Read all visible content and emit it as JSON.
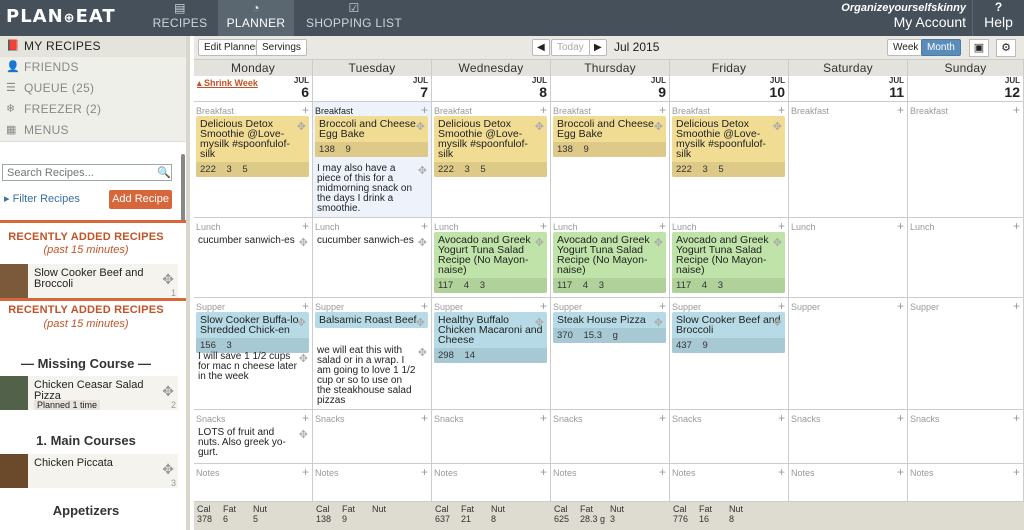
{
  "app": {
    "logo": "PLAN TO EAT"
  },
  "nav": {
    "recipes": "RECIPES",
    "planner": "PLANNER",
    "shopping": "SHOPPING LIST"
  },
  "account": {
    "user": "Organizeyourselfskinny",
    "label": "My Account",
    "help": "Help"
  },
  "sidebar": {
    "items": [
      {
        "label": "MY RECIPES",
        "icon": "book-icon"
      },
      {
        "label": "FRIENDS",
        "icon": "person-icon"
      },
      {
        "label": "QUEUE (25)",
        "icon": "list-icon"
      },
      {
        "label": "FREEZER (2)",
        "icon": "snowflake-icon"
      },
      {
        "label": "MENUS",
        "icon": "menu-icon"
      }
    ],
    "search_placeholder": "Search Recipes...",
    "filter": "Filter Recipes",
    "add_recipe": "Add Recipe",
    "recent_title": "RECENTLY ADDED RECIPES",
    "recent_sub": "(past 15 minutes)",
    "recent_item": "Slow Cooker Beef and Broccoli",
    "recent_count": "1",
    "missing": "— Missing Course —",
    "missing_item": "Chicken Ceasar Salad Pizza",
    "missing_badge": "Planned 1 time",
    "missing_count": "2",
    "main_courses": "1. Main Courses",
    "main_item": "Chicken Piccata",
    "main_count": "3",
    "appetizers": "Appetizers"
  },
  "toolbar": {
    "edit_planner": "Edit Planner",
    "servings": "Servings",
    "today": "Today",
    "month_title": "Jul 2015",
    "week": "Week",
    "month": "Month"
  },
  "calendar": {
    "shrink": "Shrink Week",
    "month_abbr": "JUL",
    "days": [
      {
        "name": "Monday",
        "date": "6"
      },
      {
        "name": "Tuesday",
        "date": "7"
      },
      {
        "name": "Wednesday",
        "date": "8"
      },
      {
        "name": "Thursday",
        "date": "9"
      },
      {
        "name": "Friday",
        "date": "10"
      },
      {
        "name": "Saturday",
        "date": "11"
      },
      {
        "name": "Sunday",
        "date": "12"
      }
    ],
    "slots": [
      "Breakfast",
      "Lunch",
      "Supper",
      "Snacks",
      "Notes"
    ],
    "cards": {
      "mon_b": {
        "name": "Delicious Detox Smoothie @Love-mysilk #spoonfulof-silk",
        "stats": "222 3 5"
      },
      "tue_b": {
        "name": "Broccoli and Cheese Egg Bake",
        "stats": "138 9"
      },
      "tue_b_note": "I may also have a piece of this for a midmorning snack on the days I drink a smoothie.",
      "wed_b": {
        "name": "Delicious Detox Smoothie @Love-mysilk #spoonfulof-silk",
        "stats": "222 3 5"
      },
      "thu_b": {
        "name": "Broccoli and Cheese Egg Bake",
        "stats": "138 9"
      },
      "fri_b": {
        "name": "Delicious Detox Smoothie @Love-mysilk #spoonfulof-silk",
        "stats": "222 3 5"
      },
      "mon_l": "cucumber sanwich-es",
      "tue_l": "cucumber sanwich-es",
      "wed_l": {
        "name": "Avocado and Greek Yogurt Tuna Salad Recipe (No Mayon-naise)",
        "stats": "117 4 3"
      },
      "thu_l": {
        "name": "Avocado and Greek Yogurt Tuna Salad Recipe (No Mayon-naise)",
        "stats": "117 4 3"
      },
      "fri_l": {
        "name": "Avocado and Greek Yogurt Tuna Salad Recipe (No Mayon-naise)",
        "stats": "117 4 3"
      },
      "mon_s": {
        "name": "Slow Cooker Buffa-lo Shredded Chick-en",
        "stats": "156 3"
      },
      "mon_s_note": "I will save 1 1/2 cups for mac n cheese later in the week",
      "tue_s": {
        "name": "Balsamic Roast Beef",
        "stats": ""
      },
      "tue_s_note": "we will eat this with salad or in a wrap. I am going to love 1 1/2 cup or so to use on the steakhouse salad pizzas",
      "wed_s": {
        "name": "Healthy Buffalo Chicken Macaroni and Cheese",
        "stats": "298 14"
      },
      "thu_s": {
        "name": "Steak House Pizza",
        "stats": "370 15.3 g"
      },
      "fri_s": {
        "name": "Slow Cooker Beef and Broccoli",
        "stats": "437 9"
      },
      "mon_sn": "LOTS of fruit and nuts. Also greek yo-gurt."
    },
    "totals": [
      {
        "cal": "378",
        "fat": "6",
        "nut": "5"
      },
      {
        "cal": "138",
        "fat": "9",
        "nut": ""
      },
      {
        "cal": "637",
        "fat": "21",
        "nut": "8"
      },
      {
        "cal": "625",
        "fat": "28.3 g",
        "nut": "3"
      },
      {
        "cal": "776",
        "fat": "16",
        "nut": "8"
      }
    ],
    "total_labels": {
      "cal": "Cal",
      "fat": "Fat",
      "nut": "Nut"
    }
  },
  "colors": {
    "breakfast": "#f1dc94",
    "lunch": "#bfe3a8",
    "supper": "#b6dbe6",
    "accent": "#d7663a",
    "header": "#45505a"
  }
}
